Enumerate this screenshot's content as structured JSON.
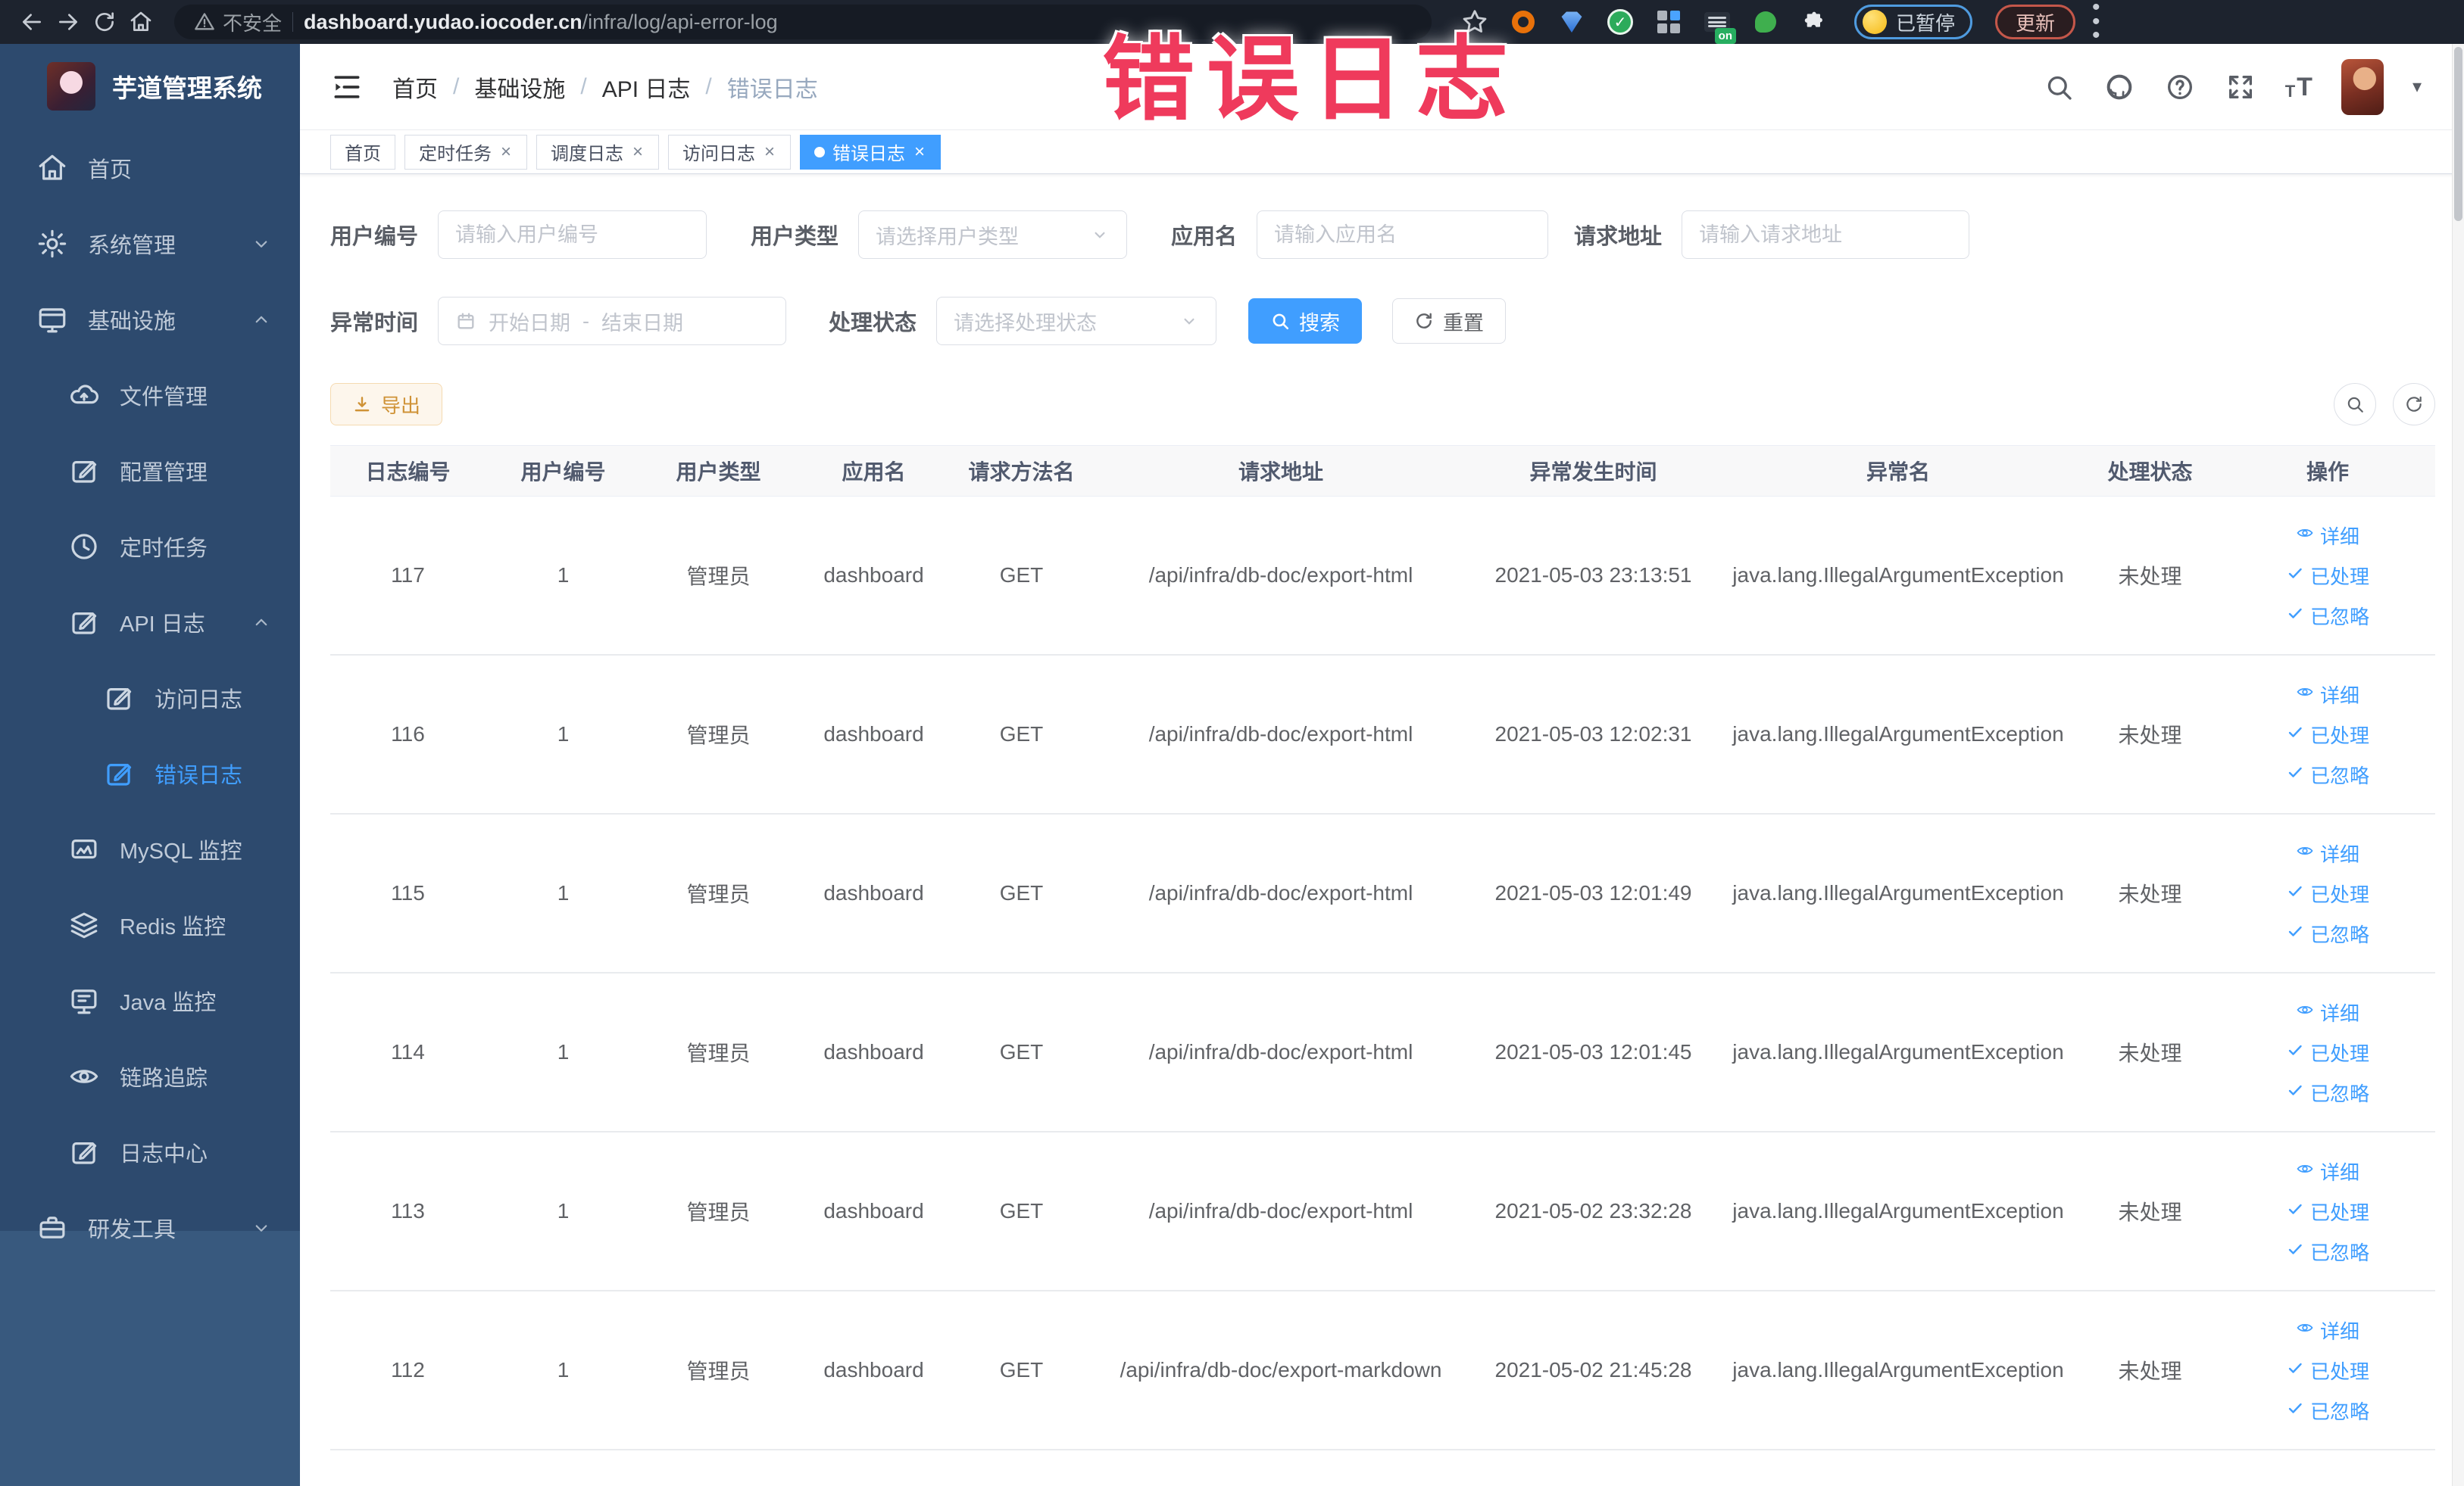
{
  "browser": {
    "security_label": "不安全",
    "url_host": "dashboard.yudao.iocoder.cn",
    "url_path": "/infra/log/api-error-log",
    "on_badge": "on",
    "paused_label": "已暂停",
    "update_label": "更新"
  },
  "watermark": "错误日志",
  "colors": {
    "primary": "#409eff",
    "active_tab": "#409eff",
    "warn_text": "#cf9236",
    "watermark_red": "#ef3a5c"
  },
  "sidebar": {
    "title": "芋道管理系统",
    "items": [
      {
        "key": "home",
        "label": "首页",
        "icon": "home",
        "indent": 0
      },
      {
        "key": "system-mgmt",
        "label": "系统管理",
        "icon": "gear",
        "indent": 0,
        "chevron": "down"
      },
      {
        "key": "infra",
        "label": "基础设施",
        "icon": "infra",
        "indent": 0,
        "chevron": "up"
      },
      {
        "key": "file-mgmt",
        "label": "文件管理",
        "icon": "cloud",
        "indent": 1
      },
      {
        "key": "config-mgmt",
        "label": "配置管理",
        "icon": "edit",
        "indent": 1
      },
      {
        "key": "scheduled-jobs",
        "label": "定时任务",
        "icon": "clock",
        "indent": 1
      },
      {
        "key": "api-log",
        "label": "API 日志",
        "icon": "edit",
        "indent": 1,
        "chevron": "up"
      },
      {
        "key": "access-log",
        "label": "访问日志",
        "icon": "edit",
        "indent": 2
      },
      {
        "key": "error-log",
        "label": "错误日志",
        "icon": "edit",
        "indent": 2,
        "active": true
      },
      {
        "key": "mysql-monitor",
        "label": "MySQL 监控",
        "icon": "db",
        "indent": 1
      },
      {
        "key": "redis-monitor",
        "label": "Redis 监控",
        "icon": "layers",
        "indent": 1
      },
      {
        "key": "java-monitor",
        "label": "Java 监控",
        "icon": "java",
        "indent": 1
      },
      {
        "key": "trace",
        "label": "链路追踪",
        "icon": "eye",
        "indent": 1
      },
      {
        "key": "log-center",
        "label": "日志中心",
        "icon": "edit",
        "indent": 1
      },
      {
        "key": "dev-tools",
        "label": "研发工具",
        "icon": "toolbox",
        "indent": 0,
        "chevron": "down",
        "section": "bottom"
      }
    ]
  },
  "navbar": {
    "breadcrumb": [
      {
        "key": "home",
        "label": "首页"
      },
      {
        "key": "infra",
        "label": "基础设施"
      },
      {
        "key": "api-log",
        "label": "API 日志"
      },
      {
        "key": "error-log",
        "label": "错误日志",
        "current": true
      }
    ]
  },
  "tabs": [
    {
      "key": "home",
      "label": "首页",
      "closable": false,
      "active": false
    },
    {
      "key": "scheduled-jobs",
      "label": "定时任务",
      "closable": true,
      "active": false
    },
    {
      "key": "schedule-log",
      "label": "调度日志",
      "closable": true,
      "active": false
    },
    {
      "key": "access-log",
      "label": "访问日志",
      "closable": true,
      "active": false
    },
    {
      "key": "error-log",
      "label": "错误日志",
      "closable": true,
      "active": true
    }
  ],
  "filters": {
    "user_id_label": "用户编号",
    "user_id_placeholder": "请输入用户编号",
    "user_type_label": "用户类型",
    "user_type_placeholder": "请选择用户类型",
    "app_name_label": "应用名",
    "app_name_placeholder": "请输入应用名",
    "request_url_label": "请求地址",
    "request_url_placeholder": "请输入请求地址",
    "exception_time_label": "异常时间",
    "date_start_placeholder": "开始日期",
    "date_separator": "-",
    "date_end_placeholder": "结束日期",
    "process_status_label": "处理状态",
    "process_status_placeholder": "请选择处理状态",
    "search_label": "搜索",
    "reset_label": "重置"
  },
  "toolbar": {
    "export_label": "导出"
  },
  "table": {
    "columns": [
      "日志编号",
      "用户编号",
      "用户类型",
      "应用名",
      "请求方法名",
      "请求地址",
      "异常发生时间",
      "异常名",
      "处理状态",
      "操作"
    ],
    "action_labels": [
      "详细",
      "已处理",
      "已忽略"
    ],
    "rows": [
      [
        "117",
        "1",
        "管理员",
        "dashboard",
        "GET",
        "/api/infra/db-doc/export-html",
        "2021-05-03 23:13:51",
        "java.lang.IllegalArgumentException",
        "未处理"
      ],
      [
        "116",
        "1",
        "管理员",
        "dashboard",
        "GET",
        "/api/infra/db-doc/export-html",
        "2021-05-03 12:02:31",
        "java.lang.IllegalArgumentException",
        "未处理"
      ],
      [
        "115",
        "1",
        "管理员",
        "dashboard",
        "GET",
        "/api/infra/db-doc/export-html",
        "2021-05-03 12:01:49",
        "java.lang.IllegalArgumentException",
        "未处理"
      ],
      [
        "114",
        "1",
        "管理员",
        "dashboard",
        "GET",
        "/api/infra/db-doc/export-html",
        "2021-05-03 12:01:45",
        "java.lang.IllegalArgumentException",
        "未处理"
      ],
      [
        "113",
        "1",
        "管理员",
        "dashboard",
        "GET",
        "/api/infra/db-doc/export-html",
        "2021-05-02 23:32:28",
        "java.lang.IllegalArgumentException",
        "未处理"
      ],
      [
        "112",
        "1",
        "管理员",
        "dashboard",
        "GET",
        "/api/infra/db-doc/export-markdown",
        "2021-05-02 21:45:28",
        "java.lang.IllegalArgumentException",
        "未处理"
      ]
    ]
  }
}
